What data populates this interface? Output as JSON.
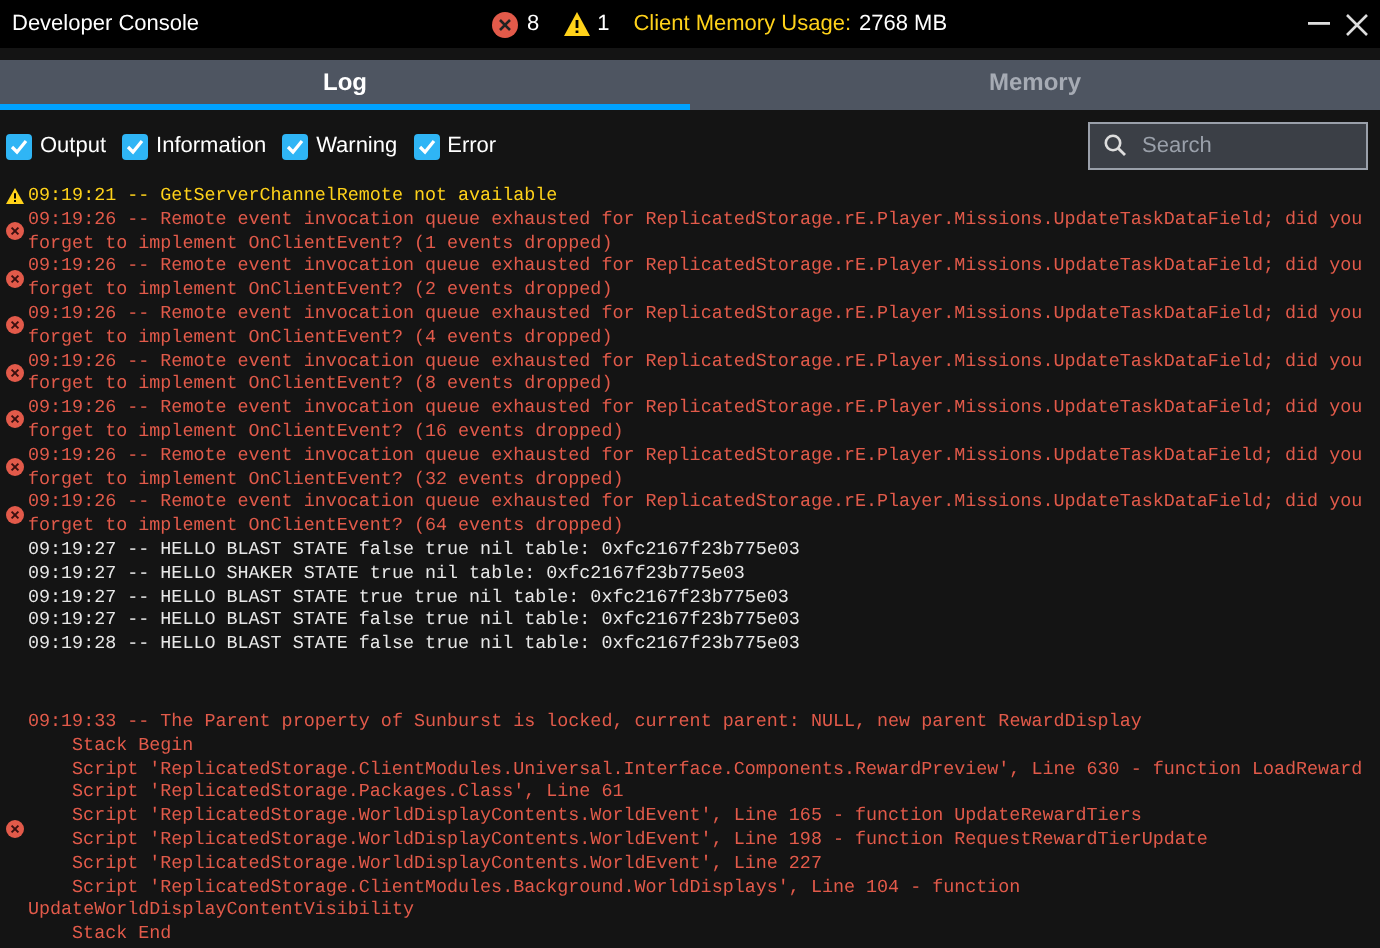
{
  "window": {
    "title": "Developer Console",
    "error_count": "8",
    "warning_count": "1",
    "memory_label": "Client Memory Usage:",
    "memory_value": "2768 MB"
  },
  "tabs": [
    {
      "label": "Log",
      "selected": true
    },
    {
      "label": "Memory",
      "selected": false
    }
  ],
  "filters": [
    {
      "label": "Output",
      "checked": true
    },
    {
      "label": "Information",
      "checked": true
    },
    {
      "label": "Warning",
      "checked": true
    },
    {
      "label": "Error",
      "checked": true
    }
  ],
  "search": {
    "placeholder": "Search"
  },
  "log": [
    {
      "kind": "warning",
      "lines": [
        {
          "text": "09:19:21 -- GetServerChannelRemote not available",
          "indented": false
        }
      ]
    },
    {
      "kind": "error",
      "lines": [
        {
          "text": "09:19:26 -- Remote event invocation queue exhausted for ReplicatedStorage.rE.Player.Missions.UpdateTaskDataField; did you",
          "indented": false
        },
        {
          "text": "forget to implement OnClientEvent? (1 events dropped)",
          "indented": false
        }
      ]
    },
    {
      "kind": "error",
      "lines": [
        {
          "text": "09:19:26 -- Remote event invocation queue exhausted for ReplicatedStorage.rE.Player.Missions.UpdateTaskDataField; did you",
          "indented": false
        },
        {
          "text": "forget to implement OnClientEvent? (2 events dropped)",
          "indented": false
        }
      ]
    },
    {
      "kind": "error",
      "lines": [
        {
          "text": "09:19:26 -- Remote event invocation queue exhausted for ReplicatedStorage.rE.Player.Missions.UpdateTaskDataField; did you",
          "indented": false
        },
        {
          "text": "forget to implement OnClientEvent? (4 events dropped)",
          "indented": false
        }
      ]
    },
    {
      "kind": "error",
      "lines": [
        {
          "text": "09:19:26 -- Remote event invocation queue exhausted for ReplicatedStorage.rE.Player.Missions.UpdateTaskDataField; did you",
          "indented": false
        },
        {
          "text": "forget to implement OnClientEvent? (8 events dropped)",
          "indented": false
        }
      ]
    },
    {
      "kind": "error",
      "lines": [
        {
          "text": "09:19:26 -- Remote event invocation queue exhausted for ReplicatedStorage.rE.Player.Missions.UpdateTaskDataField; did you",
          "indented": false
        },
        {
          "text": "forget to implement OnClientEvent? (16 events dropped)",
          "indented": false
        }
      ]
    },
    {
      "kind": "error",
      "lines": [
        {
          "text": "09:19:26 -- Remote event invocation queue exhausted for ReplicatedStorage.rE.Player.Missions.UpdateTaskDataField; did you",
          "indented": false
        },
        {
          "text": "forget to implement OnClientEvent? (32 events dropped)",
          "indented": false
        }
      ]
    },
    {
      "kind": "error",
      "lines": [
        {
          "text": "09:19:26 -- Remote event invocation queue exhausted for ReplicatedStorage.rE.Player.Missions.UpdateTaskDataField; did you",
          "indented": false
        },
        {
          "text": "forget to implement OnClientEvent? (64 events dropped)",
          "indented": false
        }
      ]
    },
    {
      "kind": "output",
      "lines": [
        {
          "text": "09:19:27 -- HELLO BLAST STATE false true nil table: 0xfc2167f23b775e03",
          "indented": false
        }
      ]
    },
    {
      "kind": "output",
      "lines": [
        {
          "text": "09:19:27 -- HELLO SHAKER STATE true nil table: 0xfc2167f23b775e03",
          "indented": false
        }
      ]
    },
    {
      "kind": "output",
      "lines": [
        {
          "text": "09:19:27 -- HELLO BLAST STATE true true nil table: 0xfc2167f23b775e03",
          "indented": false
        }
      ]
    },
    {
      "kind": "output",
      "lines": [
        {
          "text": "09:19:27 -- HELLO BLAST STATE false true nil table: 0xfc2167f23b775e03",
          "indented": false
        }
      ]
    },
    {
      "kind": "output",
      "lines": [
        {
          "text": "09:19:28 -- HELLO BLAST STATE false true nil table: 0xfc2167f23b775e03",
          "indented": false
        }
      ]
    },
    {
      "kind": "error",
      "lines": [
        {
          "text": "09:19:33 -- The Parent property of Sunburst is locked, current parent: NULL, new parent RewardDisplay",
          "indented": false
        },
        {
          "text": "Stack Begin",
          "indented": true
        },
        {
          "text": "Script 'ReplicatedStorage.ClientModules.Universal.Interface.Components.RewardPreview', Line 630 - function LoadReward",
          "indented": true
        },
        {
          "text": "Script 'ReplicatedStorage.Packages.Class', Line 61",
          "indented": true
        },
        {
          "text": "Script 'ReplicatedStorage.WorldDisplayContents.WorldEvent', Line 165 - function UpdateRewardTiers",
          "indented": true
        },
        {
          "text": "Script 'ReplicatedStorage.WorldDisplayContents.WorldEvent', Line 198 - function RequestRewardTierUpdate",
          "indented": true
        },
        {
          "text": "Script 'ReplicatedStorage.WorldDisplayContents.WorldEvent', Line 227",
          "indented": true
        },
        {
          "text": "Script 'ReplicatedStorage.ClientModules.Background.WorldDisplays', Line 104 - function",
          "indented": true
        },
        {
          "text": "UpdateWorldDisplayContentVisibility",
          "indented": false
        },
        {
          "text": "Stack End",
          "indented": true
        }
      ]
    }
  ]
}
